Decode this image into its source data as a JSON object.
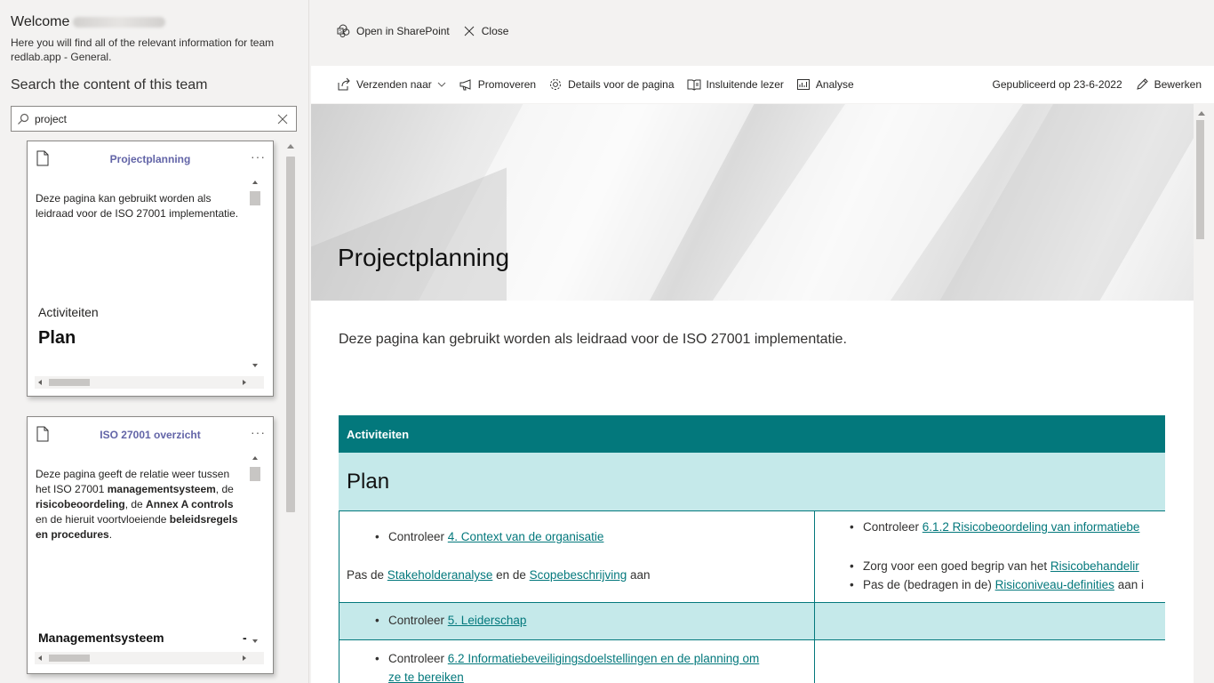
{
  "left": {
    "welcome": "Welcome",
    "intro": "Here you will find all of the relevant information for team redlab.app - General.",
    "search_heading": "Search the content of this team",
    "search_value": "project",
    "search_icon": "search-icon",
    "clear_icon": "close-icon"
  },
  "cards": [
    {
      "title": "Projectplanning",
      "more": "···",
      "body": "Deze pagina kan gebruikt worden als leidraad voor de ISO 27001 implementatie.",
      "section_label": "Activiteiten",
      "section_title": "Plan"
    },
    {
      "title": "ISO 27001 overzicht",
      "more": "···",
      "body_parts": [
        "Deze pagina geeft de relatie weer tussen het ISO 27001 ",
        "managementsysteem",
        ", de ",
        "risicobeoordeling",
        ", de ",
        "Annex A controls",
        " en de hieruit voortvloeiende ",
        "beleidsregels en procedures",
        "."
      ],
      "section_title": "Managementsysteem",
      "overflow_char": "-"
    }
  ],
  "topbar": {
    "open_sharepoint": "Open in SharePoint",
    "close": "Close"
  },
  "cmdbar": {
    "send": "Verzenden naar",
    "promote": "Promoveren",
    "details": "Details voor de pagina",
    "reader": "Insluitende lezer",
    "analysis": "Analyse",
    "published": "Gepubliceerd op 23-6-2022",
    "edit": "Bewerken"
  },
  "page": {
    "title": "Projectplanning",
    "description": "Deze pagina kan gebruikt worden als leidraad voor de ISO 27001 implementatie."
  },
  "table": {
    "header": "Activiteiten",
    "plan": "Plan",
    "r1c1_prefix": "Controleer ",
    "r1c1_link": "4. Context van de organisatie",
    "r1c1_line2_a": "Pas de ",
    "r1c1_link2": "Stakeholderanalyse",
    "r1c1_line2_b": " en de ",
    "r1c1_link3": "Scopebeschrijving",
    "r1c1_line2_c": " aan",
    "r1c2_b1_prefix": "Controleer ",
    "r1c2_b1_link": "6.1.2 Risicobeoordeling van informatiebe",
    "r1c2_b2_prefix": "Zorg voor een goed begrip van het ",
    "r1c2_b2_link": "Risicobehandelir",
    "r1c2_b3_prefix": "Pas de (bedragen in de) ",
    "r1c2_b3_link": "Risiconiveau-definities",
    "r1c2_b3_suffix": " aan i",
    "r2c1_prefix": "Controleer ",
    "r2c1_link": "5. Leiderschap",
    "r3c1_prefix": "Controleer ",
    "r3c1_link_l1": "6.2 Informatiebeveiligingsdoelstellingen en de planning om",
    "r3c1_link_l2": "ze te bereiken"
  },
  "colors": {
    "accent_teal": "#03787c",
    "light_teal": "#c5e9ea",
    "card_title": "#6264a7"
  }
}
